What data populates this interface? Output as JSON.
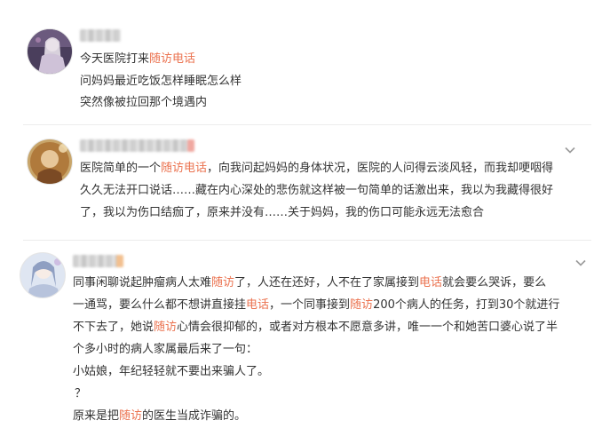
{
  "colors": {
    "text": "#333333",
    "highlight": "#eb7350",
    "divider": "#ececec",
    "chevron": "#9a9a9a"
  },
  "icons": {
    "expand": "chevron-down-icon"
  },
  "posts": [
    {
      "lines": [
        {
          "t1": "今天医院打来",
          "h1": "随访电话",
          "t2": ""
        },
        {
          "t1": "问妈妈最近吃饭怎样睡眠怎么样"
        },
        {
          "t1": "突然像被拉回那个境遇内"
        }
      ]
    },
    {
      "lines": [
        {
          "t1": "医院简单的一个",
          "h1": "随访电话",
          "t2": "，向我问起妈妈的身体状况，医院的人问得云淡风轻，而我却哽咽得"
        },
        {
          "t1": "久久无法开口说话……藏在内心深处的悲伤就这样被一句简单的话激出来，我以为我藏得很好"
        },
        {
          "t1": "了，我以为伤口结痂了，原来并没有……关于妈妈，我的伤口可能永远无法愈合"
        }
      ]
    },
    {
      "lines": [
        {
          "t1": "同事闲聊说起肿瘤病人太难",
          "h1": "随访",
          "t2": "了，人还在还好，人不在了家属接到",
          "h2": "电话",
          "t3": "就会要么哭诉，要么"
        },
        {
          "t1": "一通骂，要么什么都不想讲直接挂",
          "h1": "电话",
          "t2": "，一个同事接到",
          "h2": "随访",
          "t3": "200个病人的任务，打到30个就进行"
        },
        {
          "t1": "不下去了，她说",
          "h1": "随访",
          "t2": "心情会很抑郁的，或者对方根本不愿意多讲，唯一一个和她苦口婆心说了半"
        },
        {
          "t1": "个多小时的病人家属最后来了一句："
        },
        {
          "t1": "小姑娘，年纪轻轻就不要出来骗人了。"
        },
        {
          "t1": "？"
        },
        {
          "t1": "原来是把",
          "h1": "随访",
          "t2": "的医生当成诈骗的。"
        }
      ]
    }
  ]
}
